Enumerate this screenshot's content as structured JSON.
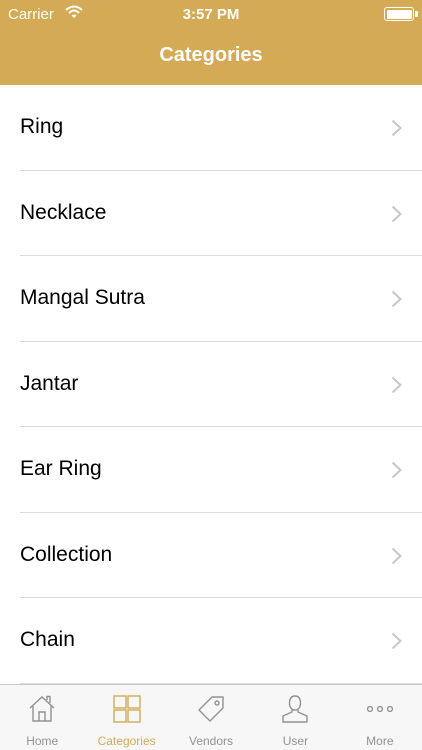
{
  "status_bar": {
    "carrier": "Carrier",
    "time": "3:57 PM"
  },
  "nav": {
    "title": "Categories"
  },
  "categories": [
    {
      "label": "Ring"
    },
    {
      "label": "Necklace"
    },
    {
      "label": "Mangal Sutra"
    },
    {
      "label": "Jantar"
    },
    {
      "label": "Ear Ring"
    },
    {
      "label": "Collection"
    },
    {
      "label": "Chain"
    }
  ],
  "tabbar": {
    "tabs": [
      {
        "label": "Home",
        "icon": "home-icon",
        "active": false
      },
      {
        "label": "Categories",
        "icon": "grid-icon",
        "active": true
      },
      {
        "label": "Vendors",
        "icon": "tag-icon",
        "active": false
      },
      {
        "label": "User",
        "icon": "user-icon",
        "active": false
      },
      {
        "label": "More",
        "icon": "more-icon",
        "active": false
      }
    ]
  },
  "colors": {
    "brand": "#d4aa55",
    "inactive": "#929292",
    "separator": "#dcdcdc"
  }
}
